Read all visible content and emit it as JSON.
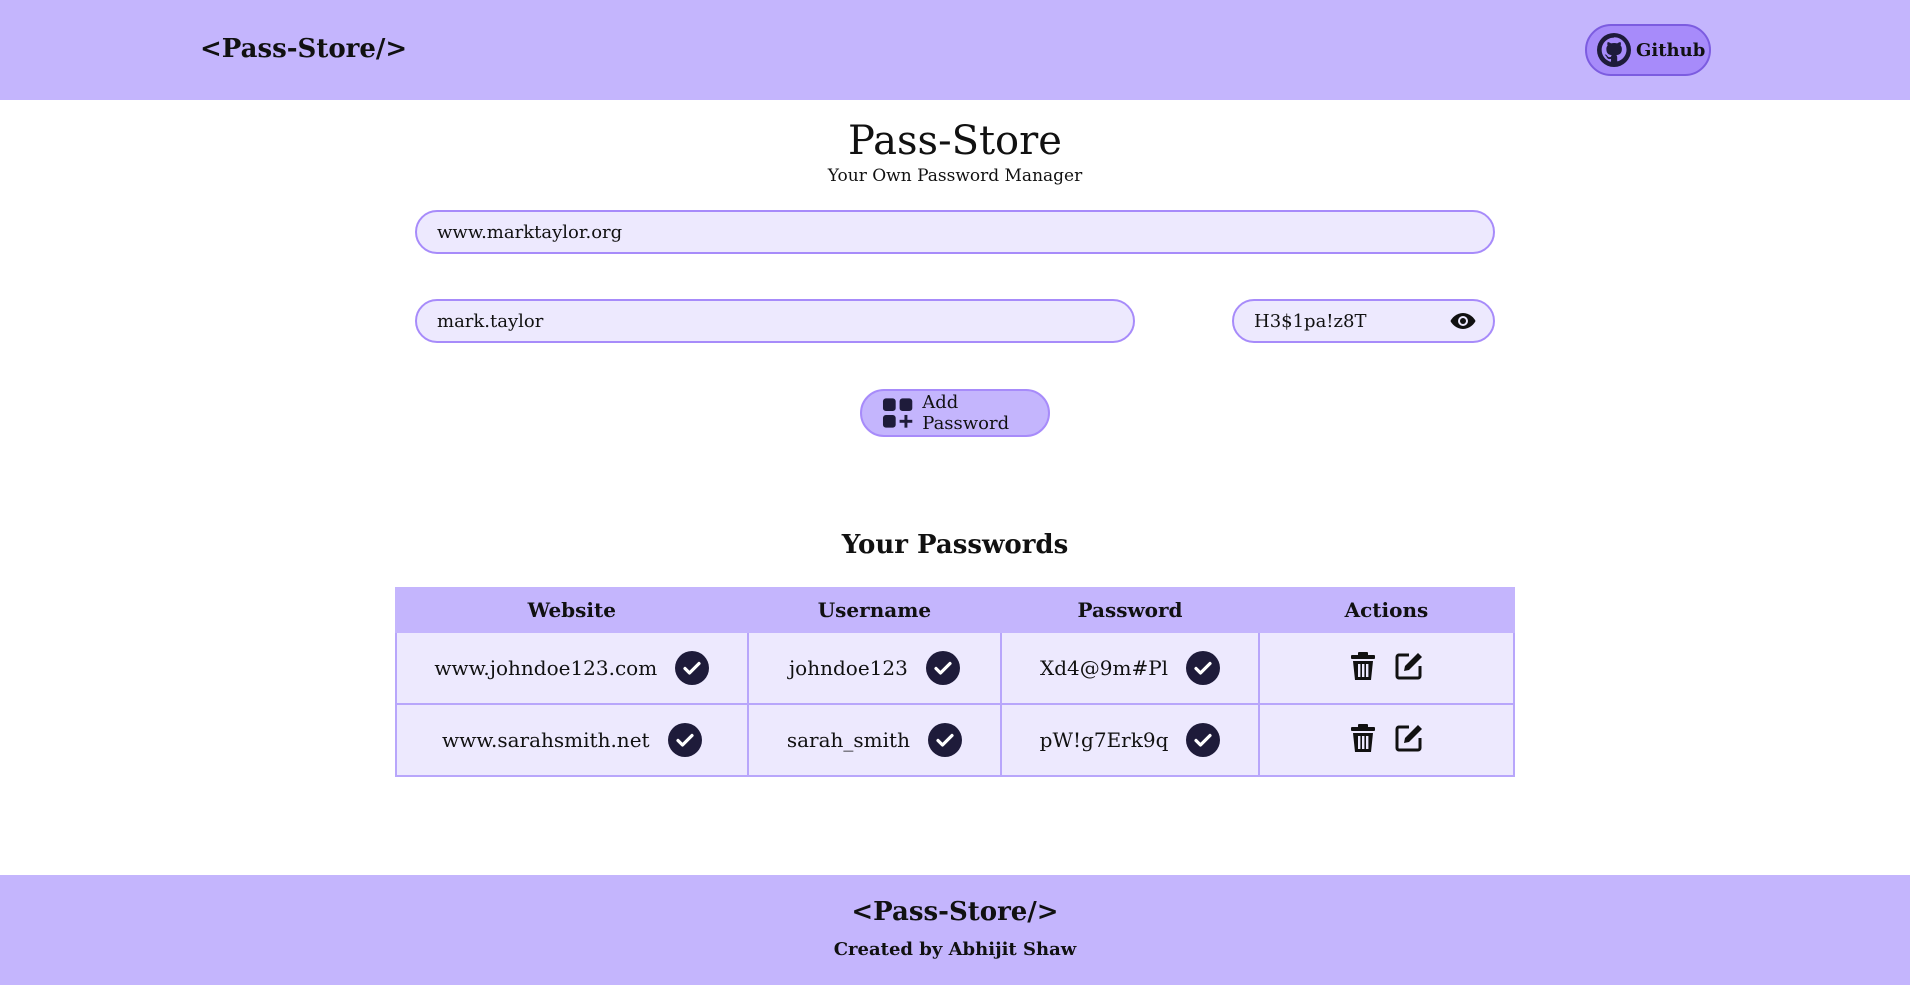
{
  "navbar": {
    "brand": "<Pass-Store/>",
    "github_label": "Github",
    "github_icon": "github-icon"
  },
  "header": {
    "title": "Pass-Store",
    "subtitle": "Your Own Password Manager"
  },
  "form": {
    "website_value": "www.marktaylor.org",
    "username_value": "mark.taylor",
    "password_value": "H3$1pa!z8T",
    "password_toggle_icon": "eye-icon",
    "add_button_label": "Add Password",
    "add_button_icon": "add-grid-icon"
  },
  "passwords": {
    "section_title": "Your Passwords",
    "columns": [
      "Website",
      "Username",
      "Password",
      "Actions"
    ],
    "rows": [
      {
        "website": "www.johndoe123.com",
        "username": "johndoe123",
        "password": "Xd4@9m#Pl"
      },
      {
        "website": "www.sarahsmith.net",
        "username": "sarah_smith",
        "password": "pW!g7Erk9q"
      }
    ],
    "copy_icon": "check-circle-icon",
    "delete_icon": "trash-icon",
    "edit_icon": "edit-icon"
  },
  "footer": {
    "brand": "<Pass-Store/>",
    "credit": "Created by Abhijit Shaw"
  },
  "colors": {
    "brand_purple": "#c4b5fd",
    "input_bg": "#ede9fe",
    "border_purple": "#a78bfa",
    "icon_dark": "#1e1b3a"
  }
}
